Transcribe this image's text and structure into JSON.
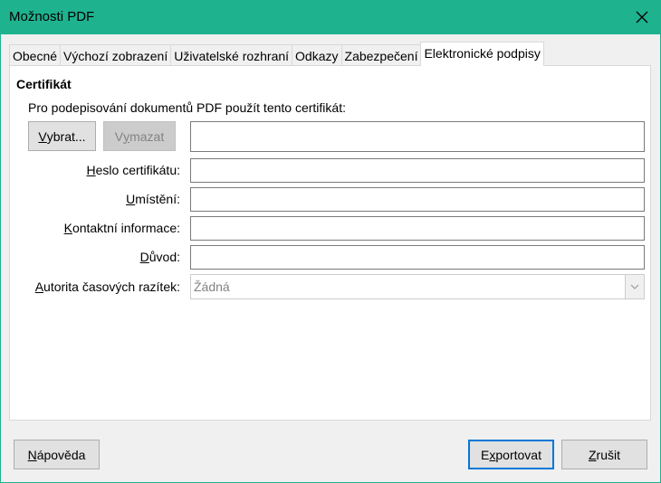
{
  "window": {
    "title": "Možnosti PDF"
  },
  "tabs": [
    {
      "label": "Obecné"
    },
    {
      "label": "Výchozí zobrazení"
    },
    {
      "label": "Uživatelské rozhraní"
    },
    {
      "label": "Odkazy"
    },
    {
      "label": "Zabezpečení"
    },
    {
      "label": "Elektronické podpisy"
    }
  ],
  "active_tab": "Elektronické podpisy",
  "certificate": {
    "section_title": "Certifikát",
    "intro_text": "Pro podepisování dokumentů PDF použít tento certifikát:",
    "select_button": {
      "mnemonic": "V",
      "rest": "ybrat..."
    },
    "clear_button": {
      "pre": "V",
      "mnemonic": "y",
      "rest": "mazat"
    },
    "certificate_value": ""
  },
  "fields": {
    "password": {
      "mnemonic": "H",
      "rest": "eslo certifikátu:",
      "value": ""
    },
    "location": {
      "mnemonic": "U",
      "rest": "místění:",
      "value": ""
    },
    "contact": {
      "mnemonic": "K",
      "rest": "ontaktní informace:",
      "value": ""
    },
    "reason": {
      "mnemonic": "D",
      "rest": "ůvod:",
      "value": ""
    },
    "tsa": {
      "mnemonic": "A",
      "rest": "utorita časových razítek:",
      "selected": "Žádná"
    }
  },
  "footer": {
    "help": {
      "mnemonic": "N",
      "rest": "ápověda"
    },
    "export": {
      "pre": "E",
      "mnemonic": "x",
      "rest": "portovat"
    },
    "cancel": {
      "mnemonic": "Z",
      "rest": "rušit"
    }
  },
  "colors": {
    "titlebar": "#1fb28f",
    "focus_border": "#0078d7"
  },
  "icons": {
    "close": "close-icon",
    "dropdown": "chevron-down-icon"
  }
}
